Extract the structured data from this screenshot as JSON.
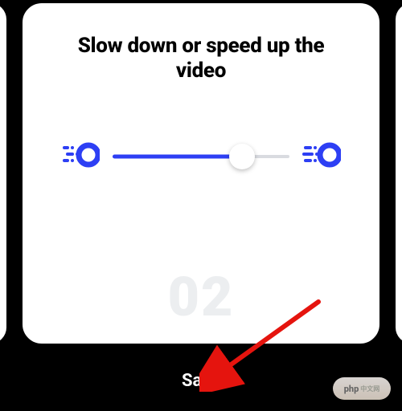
{
  "card": {
    "title": "Slow down or speed up the video",
    "step_number": "02"
  },
  "slider": {
    "value_percent": 73,
    "accent": "#2d3ff4"
  },
  "icons": {
    "slow": "slow-speed-icon",
    "fast": "fast-speed-icon"
  },
  "footer": {
    "save_label": "Save"
  },
  "watermark": {
    "brand": "php",
    "suffix": "中文网"
  }
}
